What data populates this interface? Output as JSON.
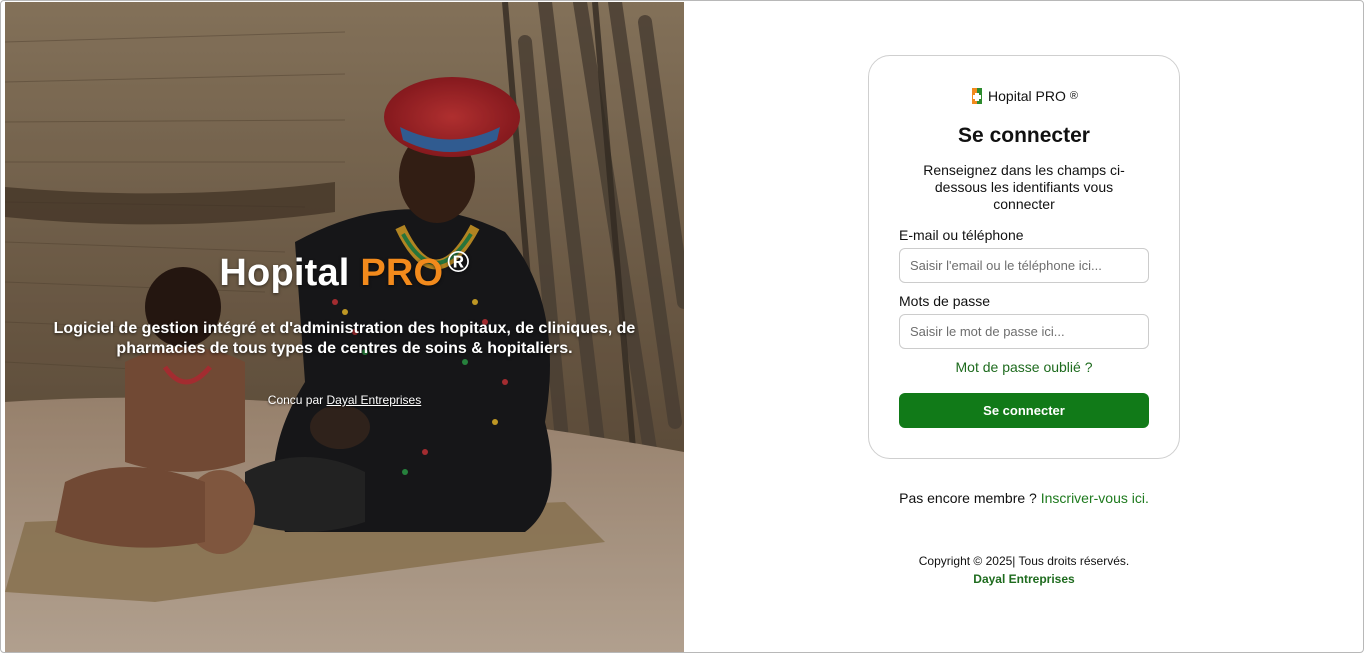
{
  "hero": {
    "title_main": "Hopital",
    "title_accent": "PRO",
    "title_mark": "®",
    "subtitle": "Logiciel de gestion intégré et d'administration des hopitaux, de cliniques, de pharmacies de tous types de centres de soins & hopitaliers.",
    "credit_prefix": "Concu par",
    "credit_link": "Dayal Entreprises"
  },
  "login": {
    "brand_name": "Hopital PRO",
    "brand_mark": "®",
    "title": "Se connecter",
    "description": "Renseignez dans les champs ci-dessous les identifiants vous connecter",
    "email_label": "E-mail ou téléphone",
    "email_placeholder": "Saisir l'email ou le téléphone ici...",
    "email_value": "",
    "password_label": "Mots de passe",
    "password_placeholder": "Saisir le mot de passe ici...",
    "password_value": "",
    "forgot_link": "Mot de passe oublié ?",
    "submit_label": "Se connecter"
  },
  "signup": {
    "prompt": "Pas encore membre ?",
    "link": "Inscriver-vous ici."
  },
  "footer": {
    "copyright": "Copyright © 2025| Tous droits réservés.",
    "company": "Dayal Entreprises"
  },
  "colors": {
    "accent_green": "#117a18",
    "link_green": "#1e6b1e",
    "brand_orange": "#f28a1c"
  },
  "icons": {
    "brand_logo": "hospital-logo-icon"
  }
}
